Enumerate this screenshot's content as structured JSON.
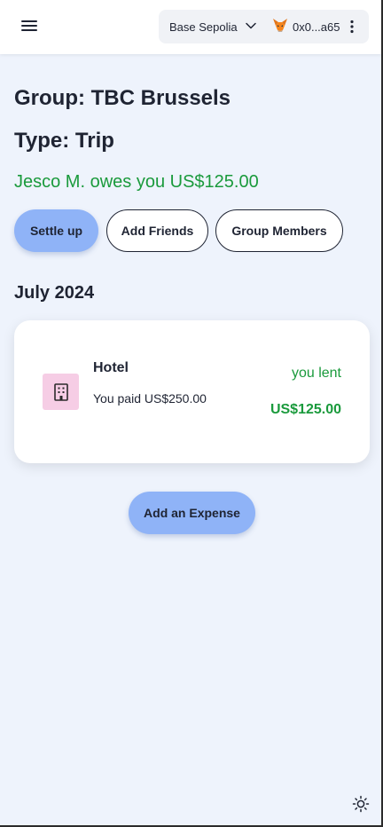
{
  "header": {
    "network": "Base Sepolia",
    "account": "0x0...a65",
    "icons": {
      "menu": "hamburger-menu-icon",
      "network_dropdown": "chevron-down-icon",
      "wallet": "metamask-fox-icon",
      "more": "vertical-dots-icon"
    }
  },
  "group": {
    "title": "Group: TBC Brussels",
    "type": "Type: Trip",
    "balance_summary": "Jesco M. owes you US$125.00"
  },
  "actions": {
    "settle_up": "Settle up",
    "add_friends": "Add Friends",
    "group_members": "Group Members"
  },
  "expenses": {
    "month_heading": "July 2024",
    "items": [
      {
        "name": "Hotel",
        "icon": "building-icon",
        "paid_text": "You paid US$250.00",
        "status": "you lent",
        "amount": "US$125.00"
      }
    ]
  },
  "footer": {
    "add_expense": "Add an Expense",
    "theme_icon": "sun-icon"
  },
  "colors": {
    "background": "#eef3fc",
    "primary_button": "#8fb3f7",
    "positive": "#1a9a3c",
    "expense_icon_bg": "#f6cde5"
  }
}
